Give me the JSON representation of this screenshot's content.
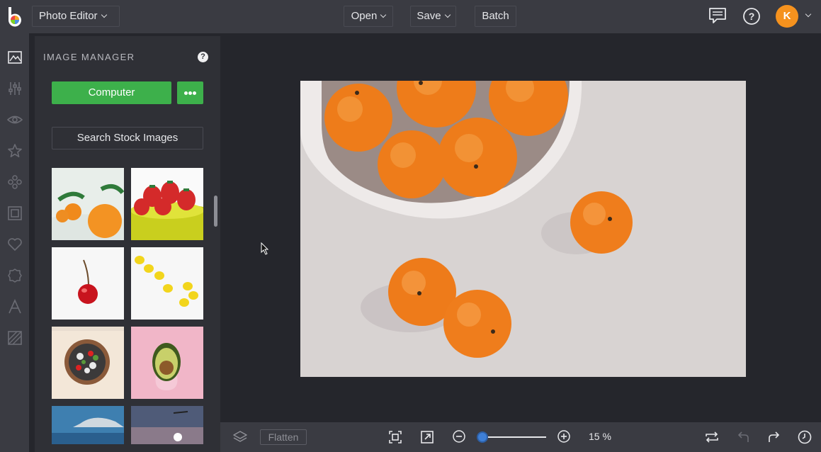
{
  "header": {
    "app_menu_label": "Photo Editor",
    "open_label": "Open",
    "save_label": "Save",
    "batch_label": "Batch",
    "user_initial": "K",
    "icons": [
      "logo-icon",
      "chat-icon",
      "help-icon",
      "chevron-down-icon"
    ]
  },
  "sidebar": {
    "tools": [
      "image-manager-icon",
      "adjust-icon",
      "eye-icon",
      "star-icon",
      "graphics-icon",
      "frame-icon",
      "heart-icon",
      "badge-icon",
      "text-icon",
      "texture-icon"
    ]
  },
  "image_manager": {
    "title": "IMAGE MANAGER",
    "help_label": "?",
    "computer_label": "Computer",
    "search_stock_label": "Search Stock Images",
    "thumbnails": [
      "oranges",
      "strawberries",
      "cherry",
      "lemons",
      "salad bowl",
      "avocado",
      "beach sky",
      "street lamp"
    ]
  },
  "bottom_bar": {
    "flatten_label": "Flatten",
    "zoom_value": "15 %",
    "zoom_fraction": 0.0
  },
  "colors": {
    "accent_green": "#3db04b",
    "avatar_orange": "#f5921e",
    "zoom_blue": "#3e7fd6",
    "topbar": "#3a3b42",
    "canvas_bg": "#25262c"
  }
}
